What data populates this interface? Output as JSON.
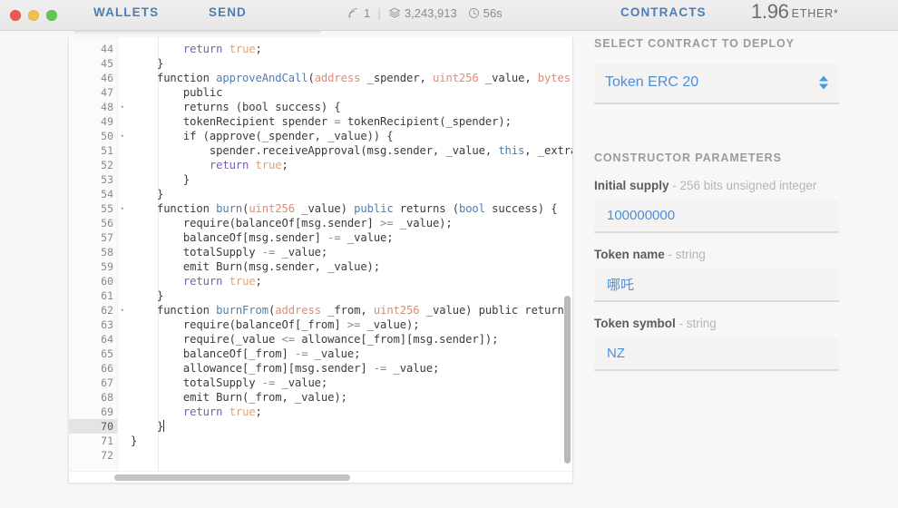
{
  "window": {
    "traffic_lights": [
      "close",
      "minimize",
      "maximize"
    ],
    "colors": {
      "close": "#ef594d",
      "minimize": "#f2bf4e",
      "maximize": "#62c655",
      "accent": "#4a90d9",
      "nav": "#4a7fb5"
    }
  },
  "nav": {
    "wallets": "WALLETS",
    "send": "SEND",
    "contracts": "CONTRACTS"
  },
  "status": {
    "peers_icon": "signal-icon",
    "peers": "1",
    "separator": "|",
    "block_icon": "blocks-icon",
    "block_number": "3,243,913",
    "time_icon": "clock-icon",
    "last_block_time": "56s"
  },
  "balance": {
    "amount": "1.96",
    "unit": "ETHER*"
  },
  "panel": {
    "select_heading": "SELECT CONTRACT TO DEPLOY",
    "selected_contract": "Token ERC 20",
    "stepper_icon": "updown-arrows-icon",
    "parameters_heading": "CONSTRUCTOR PARAMETERS",
    "fields": [
      {
        "name": "Initial supply",
        "type": "- 256 bits unsigned integer",
        "value": "100000000"
      },
      {
        "name": "Token name",
        "type": "- string",
        "value": "哪吒"
      },
      {
        "name": "Token symbol",
        "type": "- string",
        "value": "NZ"
      }
    ]
  },
  "editor": {
    "active_line": 70,
    "first_line": 44,
    "lines": [
      {
        "n": 44,
        "fold": false,
        "tokens": [
          {
            "t": "        ",
            "c": ""
          },
          {
            "t": "return",
            "c": "k"
          },
          {
            "t": " ",
            "c": ""
          },
          {
            "t": "true",
            "c": "bo"
          },
          {
            "t": ";",
            "c": ""
          }
        ]
      },
      {
        "n": 45,
        "fold": false,
        "tokens": [
          {
            "t": "    }",
            "c": ""
          }
        ]
      },
      {
        "n": 46,
        "fold": false,
        "tokens": [
          {
            "t": "    ",
            "c": ""
          },
          {
            "t": "function",
            "c": ""
          },
          {
            "t": " ",
            "c": ""
          },
          {
            "t": "approveAndCall",
            "c": "fn"
          },
          {
            "t": "(",
            "c": ""
          },
          {
            "t": "address",
            "c": "ty"
          },
          {
            "t": " _spender, ",
            "c": ""
          },
          {
            "t": "uint256",
            "c": "ty"
          },
          {
            "t": " _value, ",
            "c": ""
          },
          {
            "t": "bytes",
            "c": "ty"
          },
          {
            "t": " _",
            "c": ""
          }
        ]
      },
      {
        "n": 47,
        "fold": false,
        "tokens": [
          {
            "t": "        ",
            "c": ""
          },
          {
            "t": "public",
            "c": ""
          }
        ]
      },
      {
        "n": 48,
        "fold": true,
        "tokens": [
          {
            "t": "        returns (",
            "c": ""
          },
          {
            "t": "bool",
            "c": ""
          },
          {
            "t": " success) {",
            "c": ""
          }
        ]
      },
      {
        "n": 49,
        "fold": false,
        "tokens": [
          {
            "t": "        tokenRecipient spender ",
            "c": ""
          },
          {
            "t": "=",
            "c": "op"
          },
          {
            "t": " tokenRecipient(_spender);",
            "c": ""
          }
        ]
      },
      {
        "n": 50,
        "fold": true,
        "tokens": [
          {
            "t": "        ",
            "c": ""
          },
          {
            "t": "if",
            "c": ""
          },
          {
            "t": " (approve(_spender, _value)) {",
            "c": ""
          }
        ]
      },
      {
        "n": 51,
        "fold": false,
        "tokens": [
          {
            "t": "            spender.receiveApproval(msg.sender, _value, ",
            "c": ""
          },
          {
            "t": "this",
            "c": "kw"
          },
          {
            "t": ", _extraI",
            "c": ""
          }
        ]
      },
      {
        "n": 52,
        "fold": false,
        "tokens": [
          {
            "t": "            ",
            "c": ""
          },
          {
            "t": "return",
            "c": "k"
          },
          {
            "t": " ",
            "c": ""
          },
          {
            "t": "true",
            "c": "bo"
          },
          {
            "t": ";",
            "c": ""
          }
        ]
      },
      {
        "n": 53,
        "fold": false,
        "tokens": [
          {
            "t": "        }",
            "c": ""
          }
        ]
      },
      {
        "n": 54,
        "fold": false,
        "tokens": [
          {
            "t": "    }",
            "c": ""
          }
        ]
      },
      {
        "n": 55,
        "fold": true,
        "tokens": [
          {
            "t": "    ",
            "c": ""
          },
          {
            "t": "function",
            "c": ""
          },
          {
            "t": " ",
            "c": ""
          },
          {
            "t": "burn",
            "c": "fn"
          },
          {
            "t": "(",
            "c": ""
          },
          {
            "t": "uint256",
            "c": "ty"
          },
          {
            "t": " _value) ",
            "c": ""
          },
          {
            "t": "public",
            "c": "kw"
          },
          {
            "t": " returns (",
            "c": ""
          },
          {
            "t": "bool",
            "c": "kw"
          },
          {
            "t": " success) {",
            "c": ""
          }
        ]
      },
      {
        "n": 56,
        "fold": false,
        "tokens": [
          {
            "t": "        require(balanceOf[msg.sender] ",
            "c": ""
          },
          {
            "t": ">=",
            "c": "op"
          },
          {
            "t": " _value);",
            "c": ""
          }
        ]
      },
      {
        "n": 57,
        "fold": false,
        "tokens": [
          {
            "t": "        balanceOf[msg.sender] ",
            "c": ""
          },
          {
            "t": "-=",
            "c": "op"
          },
          {
            "t": " _value;",
            "c": ""
          }
        ]
      },
      {
        "n": 58,
        "fold": false,
        "tokens": [
          {
            "t": "        totalSupply ",
            "c": ""
          },
          {
            "t": "-=",
            "c": "op"
          },
          {
            "t": " _value;",
            "c": ""
          }
        ]
      },
      {
        "n": 59,
        "fold": false,
        "tokens": [
          {
            "t": "        emit Burn(msg.sender, _value);",
            "c": ""
          }
        ]
      },
      {
        "n": 60,
        "fold": false,
        "tokens": [
          {
            "t": "        ",
            "c": ""
          },
          {
            "t": "return",
            "c": "k"
          },
          {
            "t": " ",
            "c": ""
          },
          {
            "t": "true",
            "c": "bo"
          },
          {
            "t": ";",
            "c": ""
          }
        ]
      },
      {
        "n": 61,
        "fold": false,
        "tokens": [
          {
            "t": "    }",
            "c": ""
          }
        ]
      },
      {
        "n": 62,
        "fold": true,
        "tokens": [
          {
            "t": "    ",
            "c": ""
          },
          {
            "t": "function",
            "c": ""
          },
          {
            "t": " ",
            "c": ""
          },
          {
            "t": "burnFrom",
            "c": "fn"
          },
          {
            "t": "(",
            "c": ""
          },
          {
            "t": "address",
            "c": "ty"
          },
          {
            "t": " _from, ",
            "c": ""
          },
          {
            "t": "uint256",
            "c": "ty"
          },
          {
            "t": " _value) ",
            "c": ""
          },
          {
            "t": "public",
            "c": ""
          },
          {
            "t": " returns (",
            "c": ""
          }
        ]
      },
      {
        "n": 63,
        "fold": false,
        "tokens": [
          {
            "t": "        require(balanceOf[_from] ",
            "c": ""
          },
          {
            "t": ">=",
            "c": "op"
          },
          {
            "t": " _value);",
            "c": ""
          }
        ]
      },
      {
        "n": 64,
        "fold": false,
        "tokens": [
          {
            "t": "        require(_value ",
            "c": ""
          },
          {
            "t": "<=",
            "c": "op"
          },
          {
            "t": " allowance[_from][msg.sender]);",
            "c": ""
          }
        ]
      },
      {
        "n": 65,
        "fold": false,
        "tokens": [
          {
            "t": "        balanceOf[_from] ",
            "c": ""
          },
          {
            "t": "-=",
            "c": "op"
          },
          {
            "t": " _value;",
            "c": ""
          }
        ]
      },
      {
        "n": 66,
        "fold": false,
        "tokens": [
          {
            "t": "        allowance[_from][msg.sender] ",
            "c": ""
          },
          {
            "t": "-=",
            "c": "op"
          },
          {
            "t": " _value;",
            "c": ""
          }
        ]
      },
      {
        "n": 67,
        "fold": false,
        "tokens": [
          {
            "t": "        totalSupply ",
            "c": ""
          },
          {
            "t": "-=",
            "c": "op"
          },
          {
            "t": " _value;",
            "c": ""
          }
        ]
      },
      {
        "n": 68,
        "fold": false,
        "tokens": [
          {
            "t": "        emit Burn(_from, _value);",
            "c": ""
          }
        ]
      },
      {
        "n": 69,
        "fold": false,
        "tokens": [
          {
            "t": "        ",
            "c": ""
          },
          {
            "t": "return",
            "c": "k"
          },
          {
            "t": " ",
            "c": ""
          },
          {
            "t": "true",
            "c": "bo"
          },
          {
            "t": ";",
            "c": ""
          }
        ]
      },
      {
        "n": 70,
        "fold": false,
        "cursor": true,
        "tokens": [
          {
            "t": "    }",
            "c": ""
          }
        ]
      },
      {
        "n": 71,
        "fold": false,
        "tokens": [
          {
            "t": "}",
            "c": ""
          }
        ]
      },
      {
        "n": 72,
        "fold": false,
        "tokens": []
      }
    ]
  }
}
